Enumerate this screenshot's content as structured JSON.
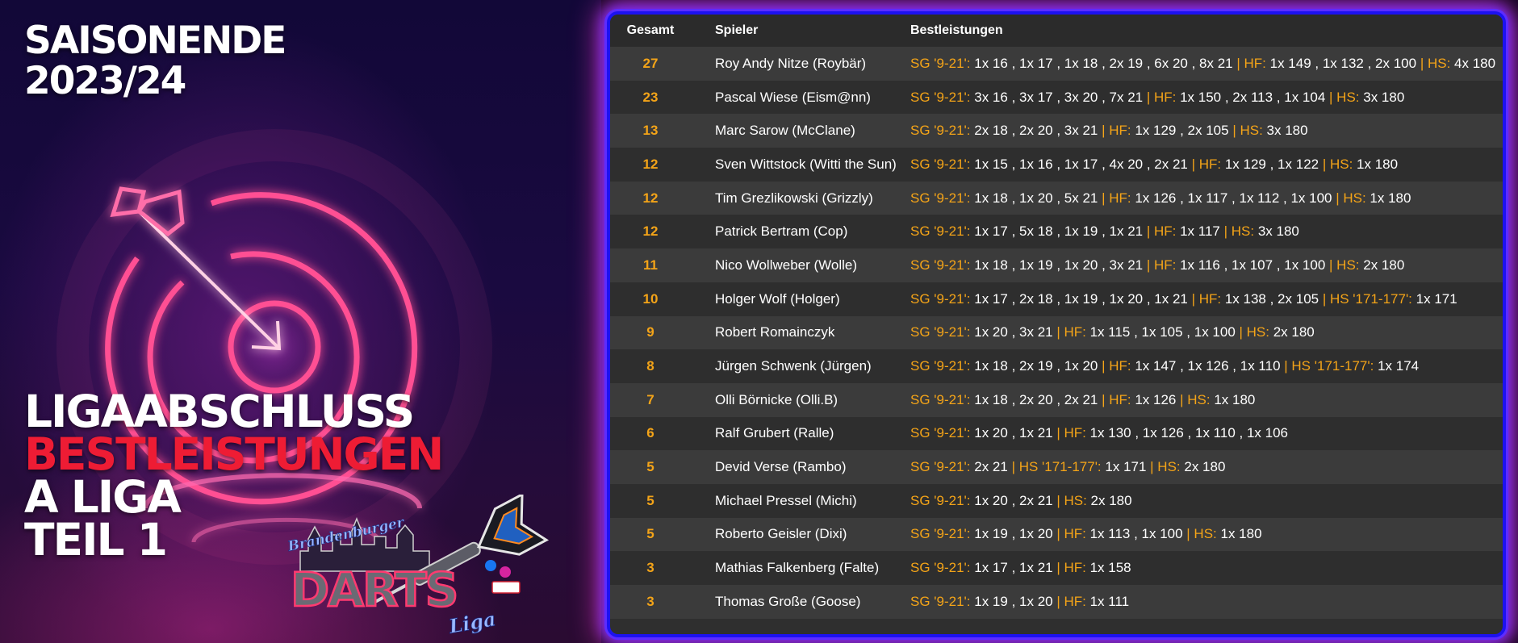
{
  "poster": {
    "season_line1": "SAISONENDE",
    "season_line2": "2023/24",
    "title_line1": "LIGAABSCHLUSS",
    "title_line2": "BESTLEISTUNGEN",
    "title_line3": "A LIGA",
    "title_line4": "TEIL 1",
    "logo_text_top": "Brandenburger",
    "logo_text_main": "DARTS",
    "logo_text_sub": "Liga",
    "colors": {
      "accent": "#f4a418",
      "headline_red": "#ee1c34",
      "neon_pink": "#ff3d8a",
      "border_blue": "#1c12f0"
    },
    "icons": [
      "dartboard-target-icon",
      "arrow-icon",
      "dart-icon",
      "facebook-icon",
      "instagram-icon"
    ]
  },
  "table": {
    "headers": {
      "total": "Gesamt",
      "player": "Spieler",
      "best": "Bestleistungen"
    },
    "rows": [
      {
        "total": "27",
        "player": "Roy Andy Nitze (Roybär)",
        "best": [
          {
            "label": "SG '9-21':",
            "value": " 1x 16 , 1x 17 , 1x 18 , 2x 19 , 6x 20 , 8x 21 "
          },
          {
            "label": "| HF:",
            "value": " 1x 149 , 1x 132 , 2x 100 "
          },
          {
            "label": "| HS:",
            "value": " 4x 180"
          }
        ]
      },
      {
        "total": "23",
        "player": "Pascal Wiese (Eism@nn)",
        "best": [
          {
            "label": "SG '9-21':",
            "value": " 3x 16 , 3x 17 , 3x 20 , 7x 21 "
          },
          {
            "label": "| HF:",
            "value": " 1x 150 , 2x 113 , 1x 104 "
          },
          {
            "label": "| HS:",
            "value": " 3x 180"
          }
        ]
      },
      {
        "total": "13",
        "player": "Marc Sarow (McClane)",
        "best": [
          {
            "label": "SG '9-21':",
            "value": " 2x 18 , 2x 20 , 3x 21 "
          },
          {
            "label": "| HF:",
            "value": " 1x 129 , 2x 105 "
          },
          {
            "label": "| HS:",
            "value": " 3x 180"
          }
        ]
      },
      {
        "total": "12",
        "player": "Sven Wittstock (Witti the Sun)",
        "best": [
          {
            "label": "SG '9-21':",
            "value": " 1x 15 , 1x 16 , 1x 17 , 4x 20 , 2x 21 "
          },
          {
            "label": "| HF:",
            "value": " 1x 129 , 1x 122 "
          },
          {
            "label": "| HS:",
            "value": " 1x 180"
          }
        ]
      },
      {
        "total": "12",
        "player": "Tim Grezlikowski (Grizzly)",
        "best": [
          {
            "label": "SG '9-21':",
            "value": " 1x 18 , 1x 20 , 5x 21 "
          },
          {
            "label": "| HF:",
            "value": " 1x 126 , 1x 117 , 1x 112 , 1x 100 "
          },
          {
            "label": "| HS:",
            "value": " 1x 180"
          }
        ]
      },
      {
        "total": "12",
        "player": "Patrick Bertram (Cop)",
        "best": [
          {
            "label": "SG '9-21':",
            "value": " 1x 17 , 5x 18 , 1x 19 , 1x 21 "
          },
          {
            "label": "| HF:",
            "value": " 1x 117 "
          },
          {
            "label": "| HS:",
            "value": " 3x 180"
          }
        ]
      },
      {
        "total": "11",
        "player": "Nico Wollweber (Wolle)",
        "best": [
          {
            "label": "SG '9-21':",
            "value": " 1x 18 , 1x 19 , 1x 20 , 3x 21 "
          },
          {
            "label": "| HF:",
            "value": " 1x 116 , 1x 107 , 1x 100 "
          },
          {
            "label": "| HS:",
            "value": " 2x 180"
          }
        ]
      },
      {
        "total": "10",
        "player": "Holger Wolf (Holger)",
        "best": [
          {
            "label": "SG '9-21':",
            "value": " 1x 17 , 2x 18 , 1x 19 , 1x 20 , 1x 21 "
          },
          {
            "label": "| HF:",
            "value": " 1x 138 , 2x 105 "
          },
          {
            "label": "| HS '171-177':",
            "value": " 1x 171"
          }
        ]
      },
      {
        "total": "9",
        "player": "Robert Romainczyk",
        "best": [
          {
            "label": "SG '9-21':",
            "value": " 1x 20 , 3x 21 "
          },
          {
            "label": "| HF:",
            "value": " 1x 115 , 1x 105 , 1x 100 "
          },
          {
            "label": "| HS:",
            "value": " 2x 180"
          }
        ]
      },
      {
        "total": "8",
        "player": "Jürgen Schwenk (Jürgen)",
        "best": [
          {
            "label": "SG '9-21':",
            "value": " 1x 18 , 2x 19 , 1x 20 "
          },
          {
            "label": "| HF:",
            "value": " 1x 147 , 1x 126 , 1x 110 "
          },
          {
            "label": "| HS '171-177':",
            "value": " 1x 174"
          }
        ]
      },
      {
        "total": "7",
        "player": "Olli Börnicke (Olli.B)",
        "best": [
          {
            "label": "SG '9-21':",
            "value": " 1x 18 , 2x 20 , 2x 21 "
          },
          {
            "label": "| HF:",
            "value": " 1x 126 "
          },
          {
            "label": "| HS:",
            "value": " 1x 180"
          }
        ]
      },
      {
        "total": "6",
        "player": "Ralf Grubert (Ralle)",
        "best": [
          {
            "label": "SG '9-21':",
            "value": " 1x 20 , 1x 21 "
          },
          {
            "label": "| HF:",
            "value": " 1x 130 , 1x 126 , 1x 110 , 1x 106"
          }
        ]
      },
      {
        "total": "5",
        "player": "Devid Verse (Rambo)",
        "best": [
          {
            "label": "SG '9-21':",
            "value": " 2x 21 "
          },
          {
            "label": "| HS '171-177':",
            "value": " 1x 171 "
          },
          {
            "label": "| HS:",
            "value": " 2x 180"
          }
        ]
      },
      {
        "total": "5",
        "player": "Michael Pressel (Michi)",
        "best": [
          {
            "label": "SG '9-21':",
            "value": " 1x 20 , 2x 21 "
          },
          {
            "label": "| HS:",
            "value": " 2x 180"
          }
        ]
      },
      {
        "total": "5",
        "player": "Roberto Geisler (Dixi)",
        "best": [
          {
            "label": "SG '9-21':",
            "value": " 1x 19 , 1x 20 "
          },
          {
            "label": "| HF:",
            "value": " 1x 113 , 1x 100 "
          },
          {
            "label": "| HS:",
            "value": " 1x 180"
          }
        ]
      },
      {
        "total": "3",
        "player": "Mathias Falkenberg (Falte)",
        "best": [
          {
            "label": "SG '9-21':",
            "value": " 1x 17 , 1x 21 "
          },
          {
            "label": "| HF:",
            "value": " 1x 158"
          }
        ]
      },
      {
        "total": "3",
        "player": "Thomas Große (Goose)",
        "best": [
          {
            "label": "SG '9-21':",
            "value": " 1x 19 , 1x 20 "
          },
          {
            "label": "| HF:",
            "value": " 1x 111"
          }
        ]
      }
    ]
  }
}
